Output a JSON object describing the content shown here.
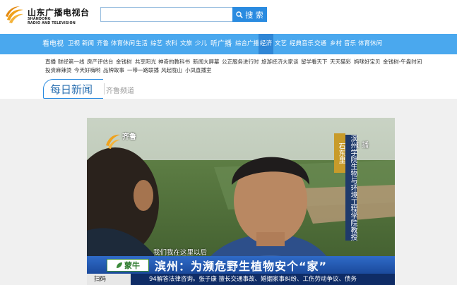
{
  "header": {
    "logo_cn": "山东广播电视台",
    "logo_en_line1": "SHANDONG",
    "logo_en_line2": "RADIO AND TELEVISION",
    "search_value": "",
    "search_button": "搜 索"
  },
  "nav": {
    "items": [
      {
        "label": "看电视"
      },
      {
        "label": "卫视"
      },
      {
        "label": "新闻"
      },
      {
        "label": "齐鲁"
      },
      {
        "label": "体育休闲"
      },
      {
        "label": "生活"
      },
      {
        "label": "综艺"
      },
      {
        "label": "农科"
      },
      {
        "label": "文旅"
      },
      {
        "label": "少儿"
      },
      {
        "label": "听广播"
      },
      {
        "label": "综合广播"
      },
      {
        "label": "经济"
      },
      {
        "label": "文艺"
      },
      {
        "label": "经典音乐"
      },
      {
        "label": "交通"
      },
      {
        "label": "乡村"
      },
      {
        "label": "音乐"
      },
      {
        "label": "体育休闲"
      }
    ]
  },
  "sublinks": {
    "row1": [
      "直播",
      "财经第一线",
      "房产评估台",
      "金钱树",
      "共享阳光",
      "神奇的教科书",
      "新闻大屏幕",
      "公正服务进行时",
      "旅游经济大家谈",
      "留学看天下",
      "天天猫彩",
      "妈咪好宝贝",
      "金钱树-午盘时间"
    ],
    "row2": [
      "投资麻辣烫",
      "今天好嗨哟",
      "品牌故事",
      "一带一路联播",
      "风起陇山",
      "小凤直播室"
    ]
  },
  "section": {
    "title": "每日新闻",
    "channel": "齐鲁频道"
  },
  "video": {
    "channel_logo": "齐鲁",
    "place": "石东里",
    "live": "直 播",
    "role": "滨州学院生物与环境工程学院教授",
    "subtitle": "我们我在这里以后",
    "sponsor": "蒙牛",
    "headline": "滨州：为濒危野生植物安个“家”",
    "ticker_label": "扫码",
    "ticker_text": "94解答法律咨询。张子康  擅长交通事故、婚姻家事纠纷、工伤劳动争议、债务"
  },
  "colors": {
    "nav_bg": "#4aa8ee",
    "nav_active": "#2f86d6",
    "accent": "#2a8be0",
    "headline_bar": "#1b4a9c"
  }
}
